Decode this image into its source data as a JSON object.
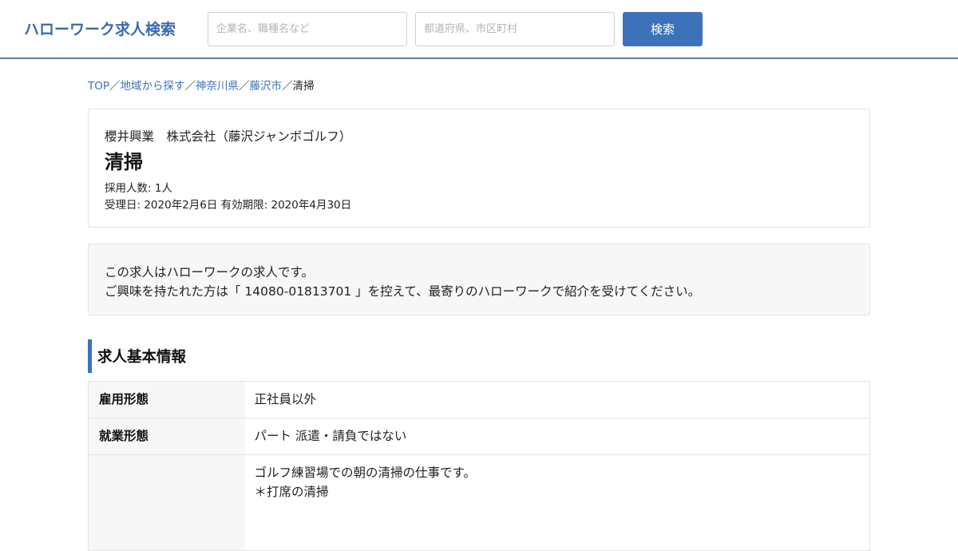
{
  "header": {
    "logo": "ハローワーク求人検索",
    "keyword_placeholder": "企業名、職種名など",
    "location_placeholder": "都道府県、市区町村",
    "search_button": "検索"
  },
  "breadcrumb": {
    "items": [
      "TOP",
      "地域から探す",
      "神奈川県",
      "藤沢市"
    ],
    "separator": "／",
    "current": "清掃"
  },
  "job": {
    "company": "櫻井興業　株式会社（藤沢ジャンボゴルフ）",
    "title": "清掃",
    "hires": "採用人数: 1人",
    "dates": "受理日: 2020年2月6日 有効期限: 2020年4月30日"
  },
  "notice": {
    "line1": "この求人はハローワークの求人です。",
    "line2": "ご興味を持たれた方は「 14080-01813701 」を控えて、最寄りのハローワークで紹介を受けてください。"
  },
  "section": {
    "title": "求人基本情報"
  },
  "info_table": {
    "rows": [
      {
        "label": "雇用形態",
        "value": "正社員以外"
      },
      {
        "label": "就業形態",
        "value": "パート 派遣・請負ではない"
      }
    ],
    "description": {
      "label": "",
      "line1": "ゴルフ練習場での朝の清掃の仕事です。",
      "line2": "＊打席の清掃"
    }
  },
  "colors": {
    "accent": "#3d72bb",
    "header_border": "#5a7aa3",
    "notice_bg": "#f7f7f7"
  }
}
